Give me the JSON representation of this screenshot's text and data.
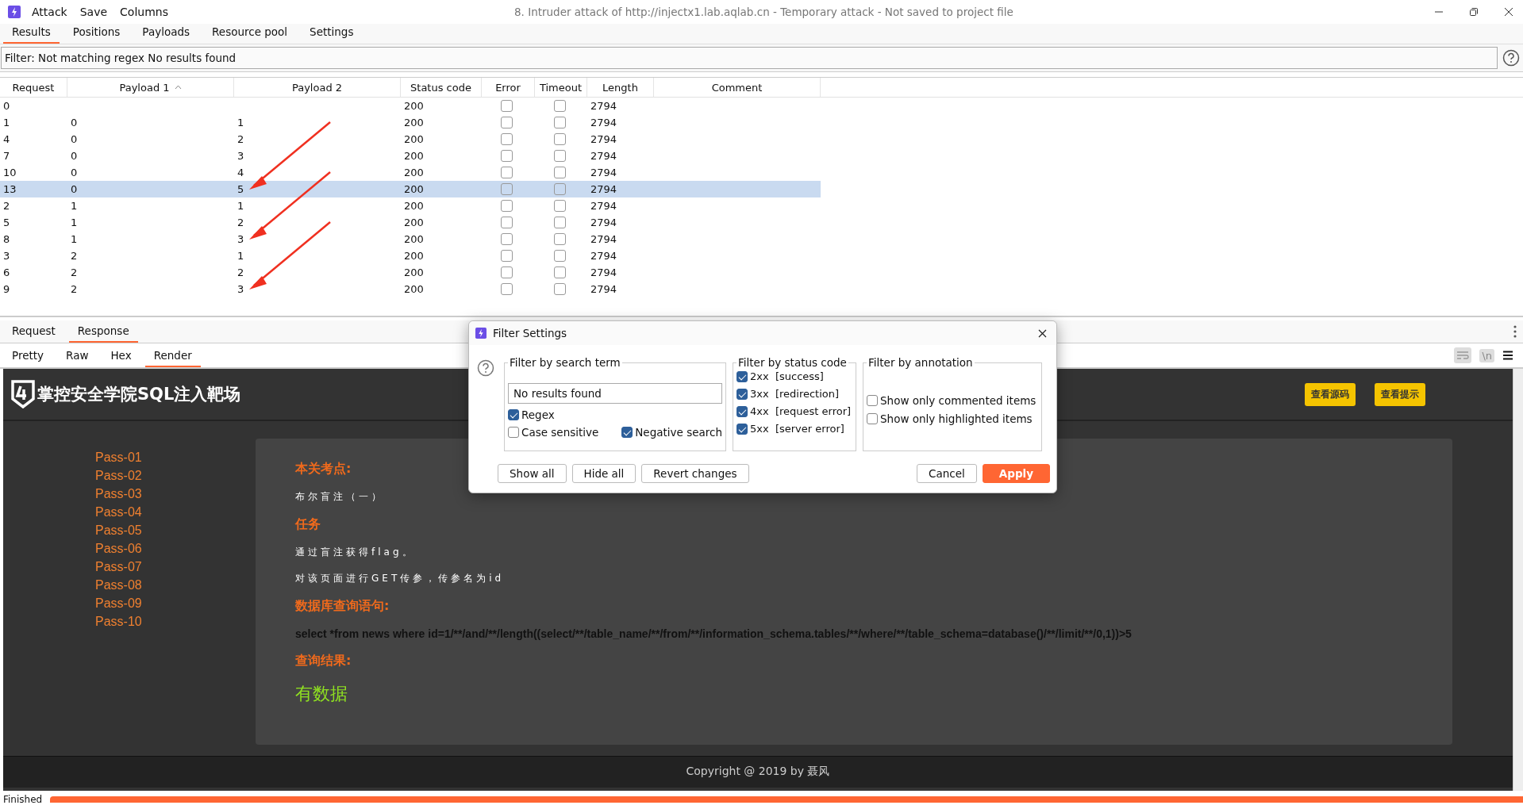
{
  "window": {
    "title": "8. Intruder attack of http://injectx1.lab.aqlab.cn - Temporary attack - Not saved to project file",
    "menu": [
      "Attack",
      "Save",
      "Columns"
    ]
  },
  "tabs": [
    {
      "label": "Results",
      "selected": true
    },
    {
      "label": "Positions",
      "selected": false
    },
    {
      "label": "Payloads",
      "selected": false
    },
    {
      "label": "Resource pool",
      "selected": false
    },
    {
      "label": "Settings",
      "selected": false
    }
  ],
  "filter_bar": {
    "text": "Filter: Not matching regex No results found"
  },
  "table": {
    "columns": [
      {
        "label": "Request",
        "sorted": false
      },
      {
        "label": "Payload 1",
        "sorted": true
      },
      {
        "label": "Payload 2",
        "sorted": false
      },
      {
        "label": "Status code",
        "sorted": false
      },
      {
        "label": "Error",
        "sorted": false
      },
      {
        "label": "Timeout",
        "sorted": false
      },
      {
        "label": "Length",
        "sorted": false
      },
      {
        "label": "Comment",
        "sorted": false
      }
    ],
    "rows": [
      {
        "request": "0",
        "payload_1": "",
        "payload_2": "",
        "status_code": "200",
        "error": false,
        "timeout": false,
        "length": "2794",
        "selected": false,
        "annotated": false
      },
      {
        "request": "1",
        "payload_1": "0",
        "payload_2": "1",
        "status_code": "200",
        "error": false,
        "timeout": false,
        "length": "2794",
        "selected": false,
        "annotated": false
      },
      {
        "request": "4",
        "payload_1": "0",
        "payload_2": "2",
        "status_code": "200",
        "error": false,
        "timeout": false,
        "length": "2794",
        "selected": false,
        "annotated": false
      },
      {
        "request": "7",
        "payload_1": "0",
        "payload_2": "3",
        "status_code": "200",
        "error": false,
        "timeout": false,
        "length": "2794",
        "selected": false,
        "annotated": false
      },
      {
        "request": "10",
        "payload_1": "0",
        "payload_2": "4",
        "status_code": "200",
        "error": false,
        "timeout": false,
        "length": "2794",
        "selected": false,
        "annotated": false
      },
      {
        "request": "13",
        "payload_1": "0",
        "payload_2": "5",
        "status_code": "200",
        "error": false,
        "timeout": false,
        "length": "2794",
        "selected": true,
        "annotated": true
      },
      {
        "request": "2",
        "payload_1": "1",
        "payload_2": "1",
        "status_code": "200",
        "error": false,
        "timeout": false,
        "length": "2794",
        "selected": false,
        "annotated": false
      },
      {
        "request": "5",
        "payload_1": "1",
        "payload_2": "2",
        "status_code": "200",
        "error": false,
        "timeout": false,
        "length": "2794",
        "selected": false,
        "annotated": false
      },
      {
        "request": "8",
        "payload_1": "1",
        "payload_2": "3",
        "status_code": "200",
        "error": false,
        "timeout": false,
        "length": "2794",
        "selected": false,
        "annotated": true
      },
      {
        "request": "3",
        "payload_1": "2",
        "payload_2": "1",
        "status_code": "200",
        "error": false,
        "timeout": false,
        "length": "2794",
        "selected": false,
        "annotated": false
      },
      {
        "request": "6",
        "payload_1": "2",
        "payload_2": "2",
        "status_code": "200",
        "error": false,
        "timeout": false,
        "length": "2794",
        "selected": false,
        "annotated": false
      },
      {
        "request": "9",
        "payload_1": "2",
        "payload_2": "3",
        "status_code": "200",
        "error": false,
        "timeout": false,
        "length": "2794",
        "selected": false,
        "annotated": true
      }
    ]
  },
  "message_tabs": [
    {
      "label": "Request",
      "selected": false
    },
    {
      "label": "Response",
      "selected": true
    }
  ],
  "view_tabs": [
    {
      "label": "Pretty",
      "selected": false
    },
    {
      "label": "Raw",
      "selected": false
    },
    {
      "label": "Hex",
      "selected": false
    },
    {
      "label": "Render",
      "selected": true
    }
  ],
  "newline_button": "\\n",
  "render": {
    "site_title": "掌控安全学院SQL注入靶场",
    "header_buttons": [
      "查看源码",
      "查看提示"
    ],
    "nav": [
      "Pass-01",
      "Pass-02",
      "Pass-03",
      "Pass-04",
      "Pass-05",
      "Pass-06",
      "Pass-07",
      "Pass-08",
      "Pass-09",
      "Pass-10"
    ],
    "content": [
      {
        "kind": "heading",
        "text": "本关考点:"
      },
      {
        "kind": "text",
        "text": "布尔盲注（一）"
      },
      {
        "kind": "heading",
        "text": "任务"
      },
      {
        "kind": "text",
        "text": "通过盲注获得flag。"
      },
      {
        "kind": "text",
        "text": "对该页面进行GET传参，传参名为id"
      },
      {
        "kind": "heading",
        "text": "数据库查询语句:"
      },
      {
        "kind": "query",
        "text": "select *from news where id=1/**/and/**/length((select/**/table_name/**/from/**/information_schema.tables/**/where/**/table_schema=database()/**/limit/**/0,1))>5"
      },
      {
        "kind": "heading",
        "text": "查询结果:"
      },
      {
        "kind": "result",
        "text": "有数据"
      }
    ],
    "footer": "Copyright @ 2019 by 聂风"
  },
  "dialog": {
    "title": "Filter Settings",
    "search_term": {
      "legend": "Filter by search term",
      "value": "No results found",
      "options": [
        {
          "label": "Regex",
          "checked": true
        },
        {
          "label": "Case sensitive",
          "checked": false
        },
        {
          "label": "Negative search",
          "checked": true
        }
      ]
    },
    "status_code": {
      "legend": "Filter by status code",
      "options": [
        {
          "code": "2xx",
          "label": "[success]",
          "checked": true
        },
        {
          "code": "3xx",
          "label": "[redirection]",
          "checked": true
        },
        {
          "code": "4xx",
          "label": "[request error]",
          "checked": true
        },
        {
          "code": "5xx",
          "label": "[server error]",
          "checked": true
        }
      ]
    },
    "annotation": {
      "legend": "Filter by annotation",
      "options": [
        {
          "label": "Show only commented items",
          "checked": false
        },
        {
          "label": "Show only highlighted items",
          "checked": false
        }
      ]
    },
    "buttons": [
      {
        "label": "Show all",
        "kind": "plain"
      },
      {
        "label": "Hide all",
        "kind": "plain"
      },
      {
        "label": "Revert changes",
        "kind": "plain"
      },
      {
        "label": "Cancel",
        "kind": "plain"
      },
      {
        "label": "Apply",
        "kind": "primary"
      }
    ]
  },
  "status_bar": {
    "text": "Finished",
    "level": 1
  }
}
